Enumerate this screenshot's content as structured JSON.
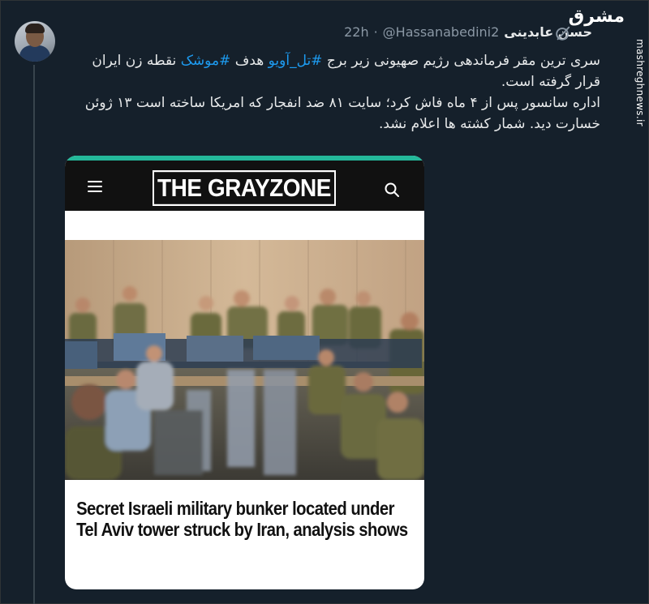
{
  "tweet": {
    "author": {
      "display_name": "حسن عابدینی",
      "handle": "@Hassanabedini2"
    },
    "separator": "·",
    "time": "22h",
    "text": {
      "line1_pre": "سری ترین مقر فرماندهی رژیم صهیونی زیر برج ",
      "hashtag1": "#تل_آویو",
      "line1_mid": " هدف ",
      "hashtag2": "#موشک",
      "line1_post": " نقطه زن ایران قرار گرفته است.",
      "paragraph2": "اداره سانسور پس از ۴ ماه فاش کرد؛ سایت ۸۱ ضد انفجار که امریکا ساخته است ۱۳ ژوئن خسارت دید. شمار کشته ها اعلام نشد."
    },
    "icons": {
      "avatar": "avatar",
      "grok": "grok-icon",
      "more": "more-icon"
    }
  },
  "watermark": {
    "logo": "مشرق",
    "site": "mashreghnews.ir"
  },
  "card": {
    "brand": "THE GRAYZONE",
    "headline": "Secret Israeli military bunker located under Tel Aviv tower struck by Iran, analysis shows",
    "icons": {
      "menu": "menu-icon",
      "search": "search-icon"
    },
    "accent_color": "#24b89a"
  },
  "colors": {
    "background": "#15202b",
    "hashtag": "#1d9bf0",
    "muted": "#8b98a5",
    "text": "#e7e9ea"
  }
}
